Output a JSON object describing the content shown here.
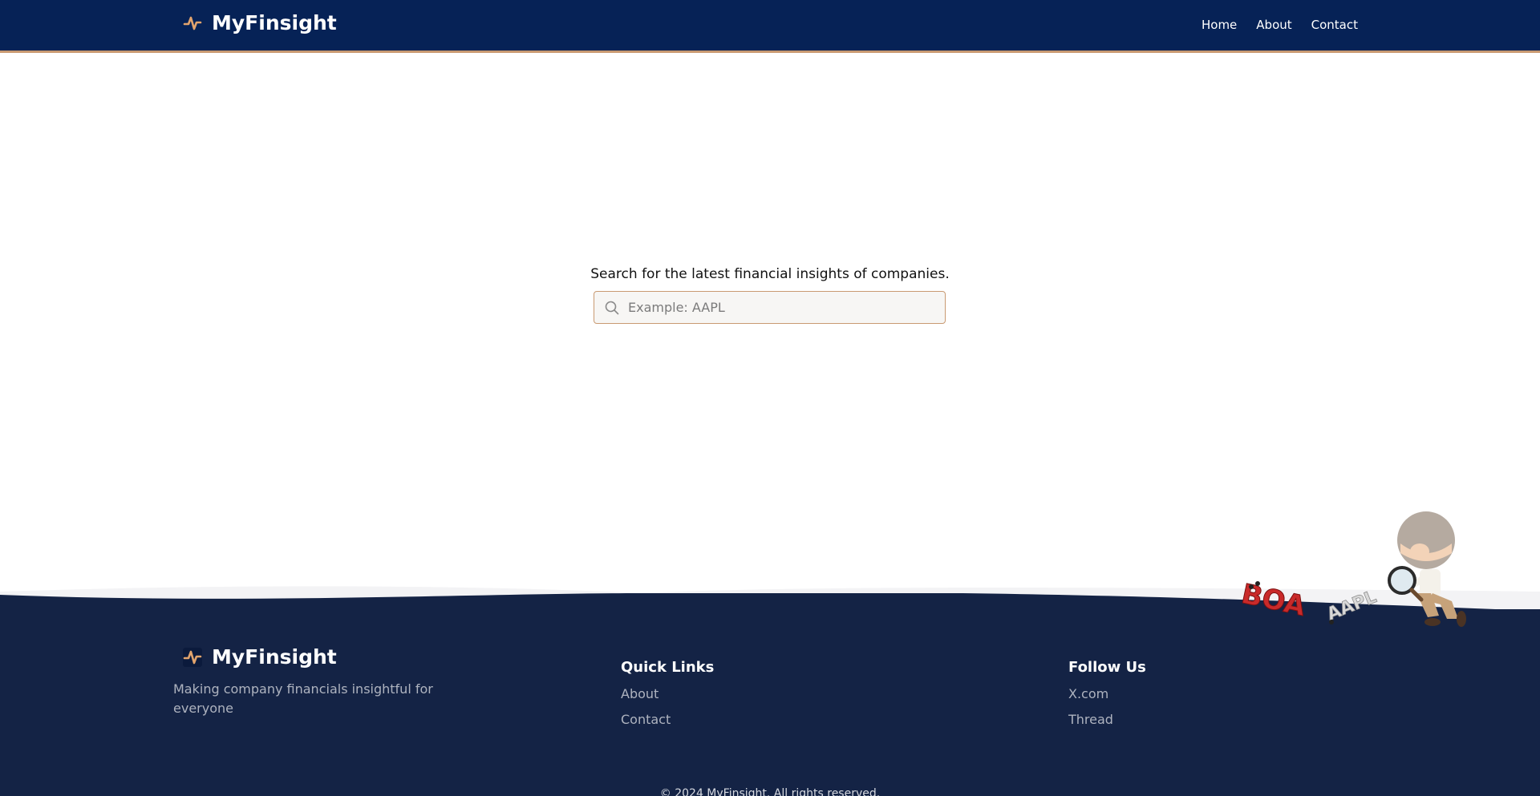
{
  "header": {
    "brand": "MyFinsight",
    "nav": [
      {
        "label": "Home"
      },
      {
        "label": "About"
      },
      {
        "label": "Contact"
      }
    ]
  },
  "main": {
    "tagline": "Search for the latest financial insights of companies.",
    "search": {
      "placeholder": "Example: AAPL",
      "value": ""
    }
  },
  "footer": {
    "brand": "MyFinsight",
    "description": "Making company financials insightful for everyone",
    "quick_links": {
      "title": "Quick Links",
      "items": [
        {
          "label": "About"
        },
        {
          "label": "Contact"
        }
      ]
    },
    "follow": {
      "title": "Follow Us",
      "items": [
        {
          "label": "X.com"
        },
        {
          "label": "Thread"
        }
      ]
    },
    "copyright": "© 2024 MyFinsight. All rights reserved.",
    "mascot_labels": [
      "BOA",
      "AAPL"
    ]
  },
  "colors": {
    "header_bg": "#062256",
    "accent": "#c99a72",
    "footer_bg": "#142345"
  }
}
